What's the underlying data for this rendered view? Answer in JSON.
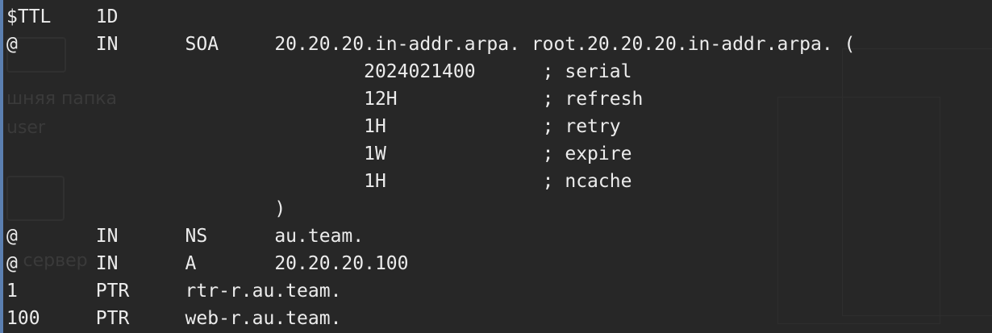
{
  "editor": {
    "lines": [
      "$TTL    1D",
      "@       IN      SOA     20.20.20.in-addr.arpa. root.20.20.20.in-addr.arpa. (",
      "                                2024021400      ; serial",
      "                                12H             ; refresh",
      "                                1H              ; retry",
      "                                1W              ; expire",
      "                                1H              ; ncache",
      "                        )",
      "@       IN      NS      au.team.",
      "@       IN      A       20.20.20.100",
      "1       PTR     rtr-r.au.team.",
      "100     PTR     web-r.au.team."
    ]
  },
  "background_desktop": {
    "folder_label": "шняя папка",
    "user_label": "user",
    "server_label": "е сервер"
  },
  "colors": {
    "background": "#272727",
    "text": "#ececec",
    "accent_border": "#5b7fb0"
  }
}
